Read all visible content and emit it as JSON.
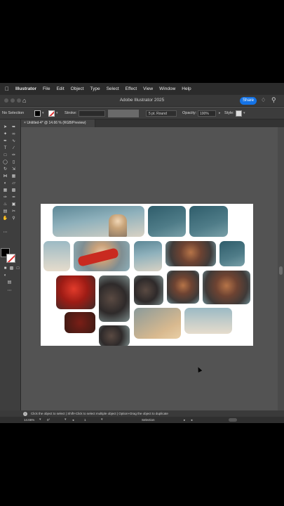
{
  "menubar": {
    "app": "Illustrator",
    "items": [
      "File",
      "Edit",
      "Object",
      "Type",
      "Select",
      "Effect",
      "View",
      "Window",
      "Help"
    ]
  },
  "appbar": {
    "title": "Adobe Illustrator 2025",
    "share_label": "Share"
  },
  "control": {
    "selection": "No Selection",
    "stroke_label": "Stroke:",
    "brush": "5 pt. Round",
    "opacity_label": "Opacity:",
    "opacity_value": "100%",
    "style_label": "Style:"
  },
  "document": {
    "tab_label": "Untitled-4* @ 14.66 % (RGB/Preview)"
  },
  "status": {
    "hint": "Click the object to select  |  Shift+Click to select multiple object  |  Option+Drag the object to duplicate",
    "zoom": "14.66%",
    "rotation": "0°",
    "artboard_num": "1",
    "tool": "Selection"
  },
  "colors": {
    "accent": "#1473e6",
    "panel": "#3e3e3e",
    "canvas": "#535353"
  },
  "icons": [
    "apple-icon",
    "home-icon",
    "bell-icon",
    "search-icon",
    "close-icon",
    "info-icon"
  ]
}
